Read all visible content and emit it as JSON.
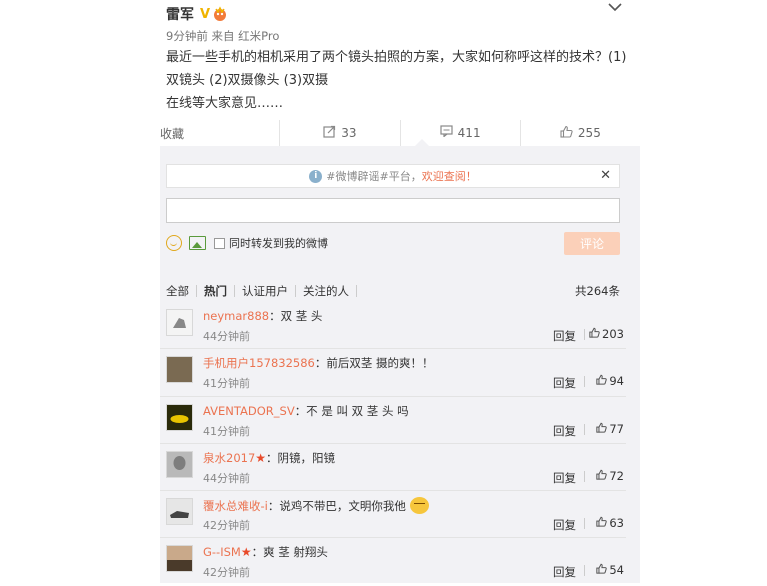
{
  "post": {
    "author": "雷军",
    "badge": "V",
    "time": "9分钟前",
    "from_label": "来自",
    "device": "红米Pro",
    "content_line1": "最近一些手机的相机采用了两个镜头拍照的方案，大家如何称呼这样的技术？(1)",
    "content_line2": "双镜头 (2)双摄像头 (3)双摄",
    "content_line3": "在线等大家意见……"
  },
  "actions": {
    "favorite_label": "收藏",
    "repost_count": "33",
    "comment_count": "411",
    "like_count": "255"
  },
  "notice": {
    "text_pre": "#微博辟谣#平台，",
    "text_link": "欢迎查阅！"
  },
  "composer": {
    "repost_label": "同时转发到我的微博",
    "submit_label": "评论"
  },
  "filters": {
    "all": "全部",
    "hot": "热门",
    "verified": "认证用户",
    "following": "关注的人",
    "total": "共264条"
  },
  "comments": [
    {
      "user": "neymar888",
      "text": "：双 茎 头",
      "time": "44分钟前",
      "reply": "回复",
      "likes": "203"
    },
    {
      "user": "手机用户157832586",
      "text": "：前后双茎  摄的爽！！",
      "time": "41分钟前",
      "reply": "回复",
      "likes": "94"
    },
    {
      "user": "AVENTADOR_SV",
      "text": "：不 是 叫 双 茎 头 吗",
      "time": "41分钟前",
      "reply": "回复",
      "likes": "77"
    },
    {
      "user": "泉水2017",
      "text": "：阴镜，阳镜",
      "time": "44分钟前",
      "reply": "回复",
      "likes": "72"
    },
    {
      "user": "覆水总难收-i",
      "text": "：说鸡不带巴，文明你我他",
      "time": "42分钟前",
      "reply": "回复",
      "likes": "63"
    },
    {
      "user": "G--ISM",
      "text": "：爽 茎 射翔头",
      "time": "42分钟前",
      "reply": "回复",
      "likes": "54"
    }
  ],
  "colors": {
    "link": "#eb7350",
    "badge": "#f0b400",
    "submit_bg": "#fbd0b9",
    "thread_bg": "#f2f2f5"
  }
}
